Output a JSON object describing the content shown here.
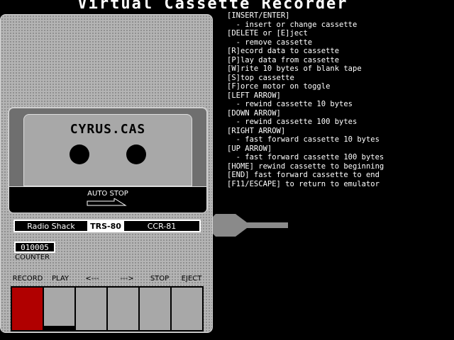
{
  "title": "Virtual Cassette Recorder",
  "cassette": {
    "label": "CYRUS.CAS"
  },
  "autostop": {
    "label": "AUTO STOP"
  },
  "brand": {
    "maker": "Radio Shack",
    "model": "TRS-80",
    "unit": "CCR-81"
  },
  "counter": {
    "value": "010005",
    "label": "COUNTER"
  },
  "keys": [
    {
      "label": "RECORD",
      "state": "active"
    },
    {
      "label": "PLAY",
      "state": "pressed"
    },
    {
      "label": "<---",
      "state": "up"
    },
    {
      "label": "--->",
      "state": "up"
    },
    {
      "label": "STOP",
      "state": "up"
    },
    {
      "label": "EJECT",
      "state": "up"
    }
  ],
  "help": [
    "[INSERT/ENTER]",
    "  - insert or change cassette",
    "[DELETE or [E]ject",
    "  - remove cassette",
    "[R]ecord data to cassette",
    "[P]lay data from cassette",
    "[W]rite 10 bytes of blank tape",
    "[S]top cassette",
    "[F]orce motor on toggle",
    "[LEFT ARROW]",
    "  - rewind cassette 10 bytes",
    "[DOWN ARROW]",
    "  - rewind cassette 100 bytes",
    "[RIGHT ARROW]",
    "  - fast forward cassette 10 bytes",
    "[UP ARROW]",
    "  - fast forward cassette 100 bytes",
    "[HOME] rewind cassette to beginning",
    "[END] fast forward cassette to end",
    "[F11/ESCAPE] to return to emulator"
  ]
}
